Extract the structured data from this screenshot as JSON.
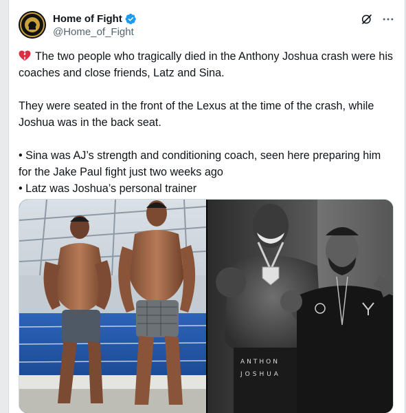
{
  "post": {
    "author": {
      "display_name": "Home of Fight",
      "handle": "@Home_of_Fight",
      "verified": true,
      "avatar_icon": "home-of-fight-logo"
    },
    "paragraphs": [
      "The two people who tragically died in the Anthony Joshua crash were his coaches and close friends, Latz and Sina.",
      "They were seated in the front of the Lexus at the time of the crash, while Joshua was in the back seat.",
      "• Sina was AJ’s strength and conditioning coach, seen here preparing him for the Jake Paul fight just two weeks ago",
      "• Latz was Joshua’s personal trainer"
    ],
    "lead_emoji": "broken-heart-icon",
    "media": {
      "count": 2,
      "left_photo": "two-shirtless-men-poolside",
      "right_photo": "joshua-and-trainer-black-and-white",
      "shorts_text_line1": "ANTHON",
      "shorts_text_line2": "JOSHUA"
    }
  },
  "colors": {
    "verified": "#1d9bf0",
    "text": "#0f1419",
    "secondary": "#536471",
    "heart": "#e0245e"
  }
}
